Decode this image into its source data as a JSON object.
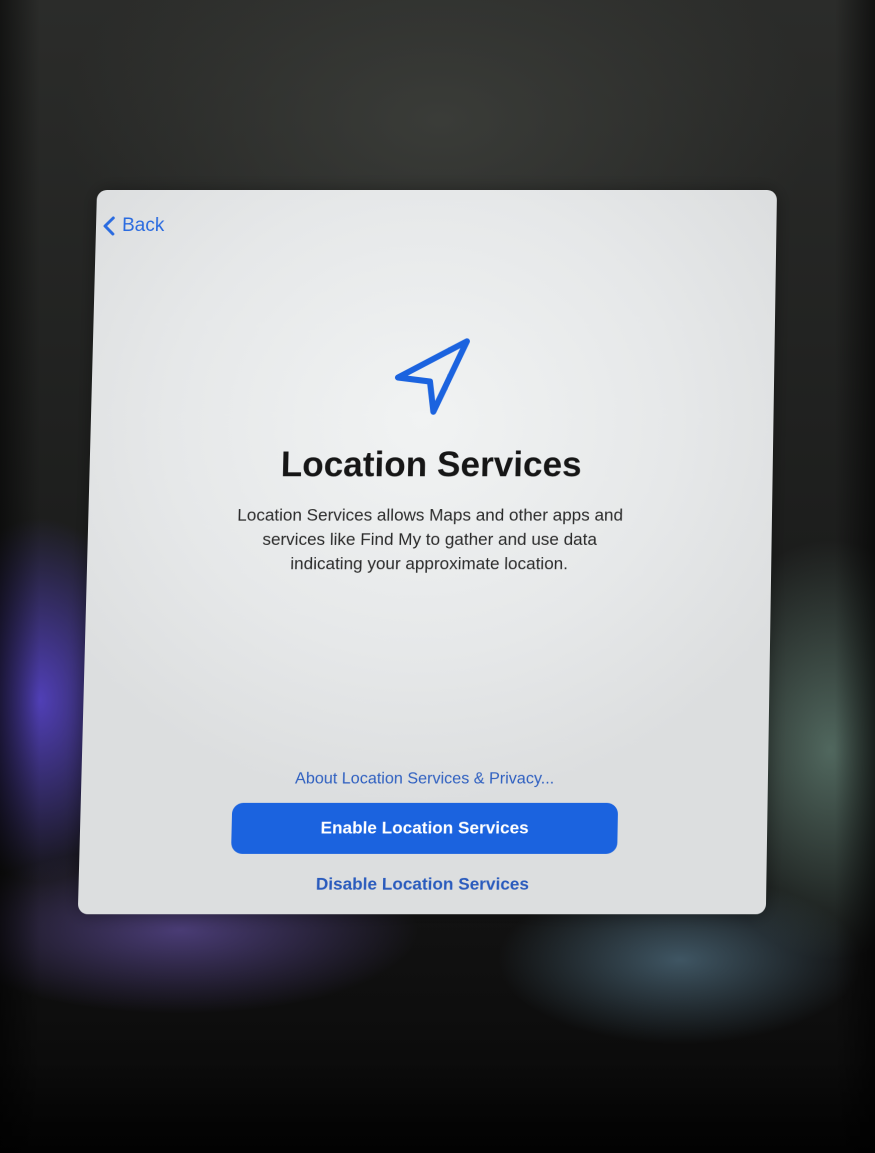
{
  "nav": {
    "back_label": "Back",
    "back_icon": "chevron-left-icon"
  },
  "main": {
    "icon": "location-arrow-icon",
    "title": "Location Services",
    "description": "Location Services allows Maps and other apps and services like Find My to gather and use data indicating your approximate location."
  },
  "actions": {
    "about_link": "About Location Services & Privacy...",
    "enable_button": "Enable Location Services",
    "disable_button": "Disable Location Services"
  },
  "colors": {
    "accent": "#1b63df",
    "card_background": "#e9ebec",
    "title_text": "#161616"
  }
}
